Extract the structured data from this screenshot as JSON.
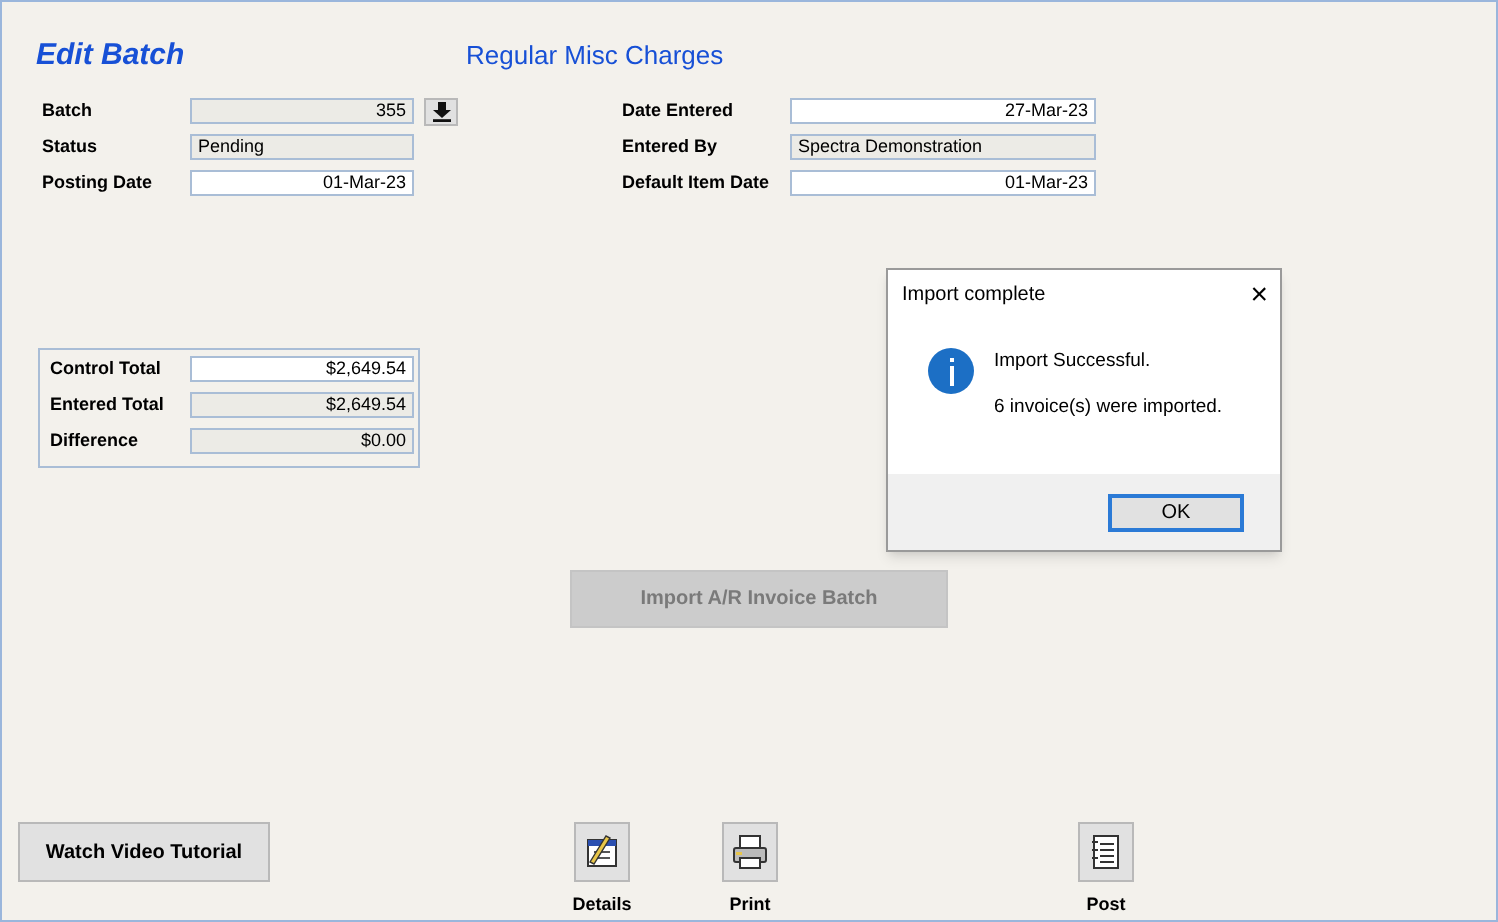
{
  "header": {
    "title": "Edit Batch",
    "subtitle": "Regular Misc Charges"
  },
  "left_fields": [
    {
      "label": "Batch",
      "value": "355",
      "readonly": true,
      "kind": "number",
      "lookup": true
    },
    {
      "label": "Status",
      "value": "Pending",
      "readonly": true,
      "kind": "text",
      "lookup": false
    },
    {
      "label": "Posting Date",
      "value": "01-Mar-23",
      "readonly": false,
      "kind": "number",
      "lookup": false
    }
  ],
  "right_fields": [
    {
      "label": "Date Entered",
      "value": "27-Mar-23",
      "readonly": false,
      "kind": "number"
    },
    {
      "label": "Entered By",
      "value": "Spectra Demonstration",
      "readonly": true,
      "kind": "text"
    },
    {
      "label": "Default Item Date",
      "value": "01-Mar-23",
      "readonly": false,
      "kind": "number"
    }
  ],
  "totals": [
    {
      "label": "Control Total",
      "value": "$2,649.54",
      "readonly": false
    },
    {
      "label": "Entered Total",
      "value": "$2,649.54",
      "readonly": true
    },
    {
      "label": "Difference",
      "value": "$0.00",
      "readonly": true
    }
  ],
  "import_button": {
    "label": "Import A/R Invoice Batch",
    "disabled": true
  },
  "tutorial_button": {
    "label": "Watch Video Tutorial"
  },
  "toolbar": [
    {
      "kind": "details",
      "label": "Details"
    },
    {
      "kind": "print",
      "label": "Print"
    },
    {
      "kind": "post",
      "label": "Post"
    }
  ],
  "dialog": {
    "title": "Import complete",
    "close": "×",
    "message": "Import Successful.",
    "detail": "6 invoice(s) were imported.",
    "button": "OK"
  }
}
